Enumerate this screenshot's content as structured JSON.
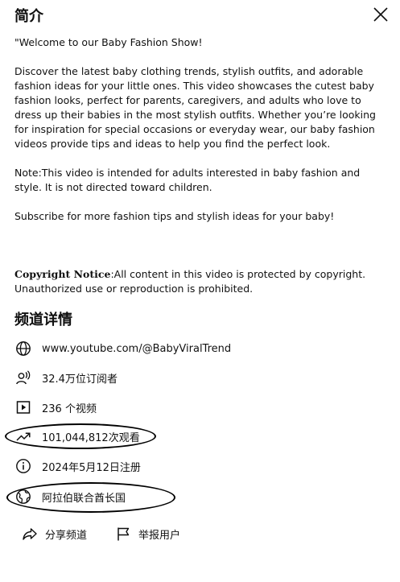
{
  "header": {
    "title": "简介"
  },
  "description": {
    "intro": "\"Welcome to our Baby Fashion Show!",
    "body": "Discover the latest baby clothing trends, stylish outfits, and adorable fashion ideas for your little ones. This video showcases the cutest baby fashion looks, perfect for parents, caregivers, and adults who love to dress up their babies in the most stylish outfits. Whether you’re looking for inspiration for special occasions or everyday wear, our baby fashion videos provide tips and ideas to help you find the perfect look.",
    "note": "Note:This video is intended for adults interested in baby fashion and style. It is not directed toward children.",
    "subscribe": "Subscribe for more fashion tips and stylish ideas for your baby!",
    "copyright_label": "Copyright Notice",
    "copyright_text": ":All content in this video is protected by copyright. Unauthorized use or reproduction is prohibited."
  },
  "channel_details": {
    "title": "频道详情",
    "url": "www.youtube.com/@BabyViralTrend",
    "subscribers": "32.4万位订阅者",
    "videos": "236 个视频",
    "views": "101,044,812次观看",
    "joined": "2024年5月12日注册",
    "country": "阿拉伯联合酋长国"
  },
  "actions": {
    "share": "分享频道",
    "report": "举报用户"
  },
  "icons": {
    "close": "close-icon",
    "globe": "globe-icon",
    "subscribers": "person-audio-icon",
    "videos": "play-square-icon",
    "views": "trending-icon",
    "info": "info-icon",
    "country": "earth-icon",
    "share": "share-arrow-icon",
    "report": "flag-icon"
  },
  "colors": {
    "text": "#0f0f0f",
    "background": "#ffffff",
    "annotation": "#000000"
  }
}
